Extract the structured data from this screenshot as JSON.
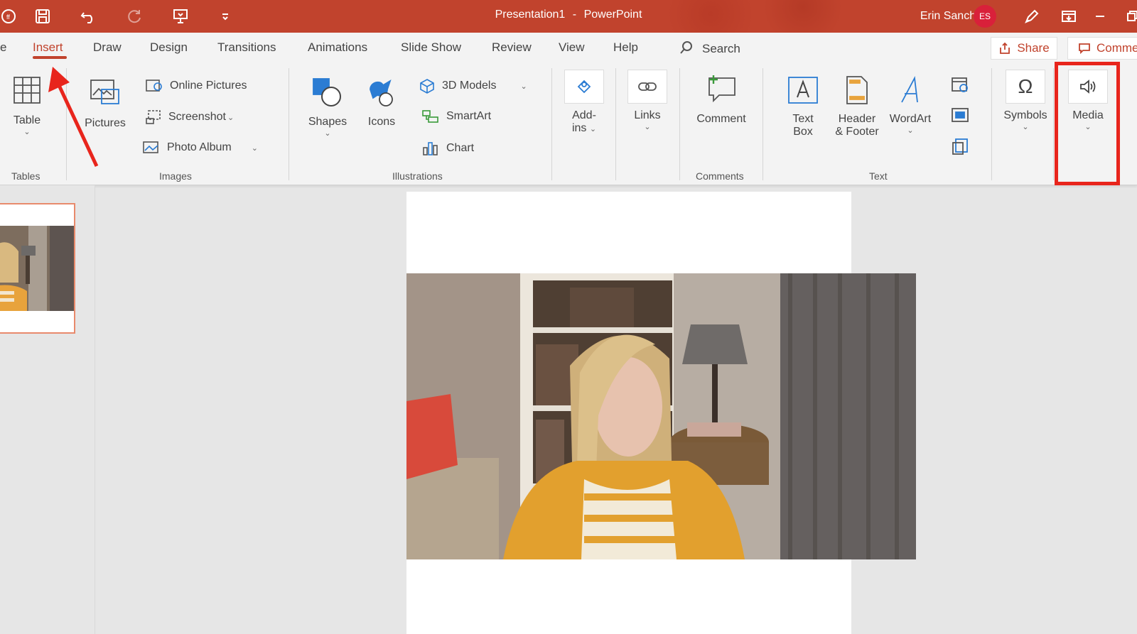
{
  "app": {
    "document_title": "Presentation1",
    "separator": "-",
    "app_name": "PowerPoint",
    "user_name": "Erin Sanchez",
    "user_initials": "ES"
  },
  "colors": {
    "accent": "#c1432d",
    "highlight_box": "#e8251c",
    "avatar": "#d9203a",
    "icon_blue": "#2b7cd3"
  },
  "tabs": [
    {
      "label": "e"
    },
    {
      "label": "Insert",
      "active": true
    },
    {
      "label": "Draw"
    },
    {
      "label": "Design"
    },
    {
      "label": "Transitions"
    },
    {
      "label": "Animations"
    },
    {
      "label": "Slide Show"
    },
    {
      "label": "Review"
    },
    {
      "label": "View"
    },
    {
      "label": "Help"
    },
    {
      "label": "Search"
    }
  ],
  "share": {
    "label": "Share"
  },
  "comments": {
    "label": "Comme"
  },
  "ribbon": {
    "tables": {
      "table": "Table",
      "group": "Tables"
    },
    "images": {
      "pictures": "Pictures",
      "online_pictures": "Online Pictures",
      "screenshot": "Screenshot",
      "photo_album": "Photo Album",
      "group": "Images"
    },
    "illustrations": {
      "shapes": "Shapes",
      "icons": "Icons",
      "models_3d": "3D Models",
      "smartart": "SmartArt",
      "chart": "Chart",
      "group": "Illustrations"
    },
    "addins": {
      "line1": "Add-",
      "line2": "ins"
    },
    "links": {
      "label": "Links"
    },
    "comments": {
      "comment": "Comment",
      "group": "Comments"
    },
    "text": {
      "text_box_1": "Text",
      "text_box_2": "Box",
      "header_1": "Header",
      "header_2": "& Footer",
      "wordart": "WordArt",
      "group": "Text"
    },
    "symbols": {
      "label": "Symbols"
    },
    "media": {
      "label": "Media"
    }
  },
  "icons": [
    "save-icon",
    "undo-icon",
    "redo-icon",
    "present-icon",
    "customize-qat-icon",
    "pen-icon",
    "ribbon-display-icon",
    "minimize-icon",
    "restore-icon",
    "search-icon",
    "share-icon",
    "comment-icon"
  ]
}
